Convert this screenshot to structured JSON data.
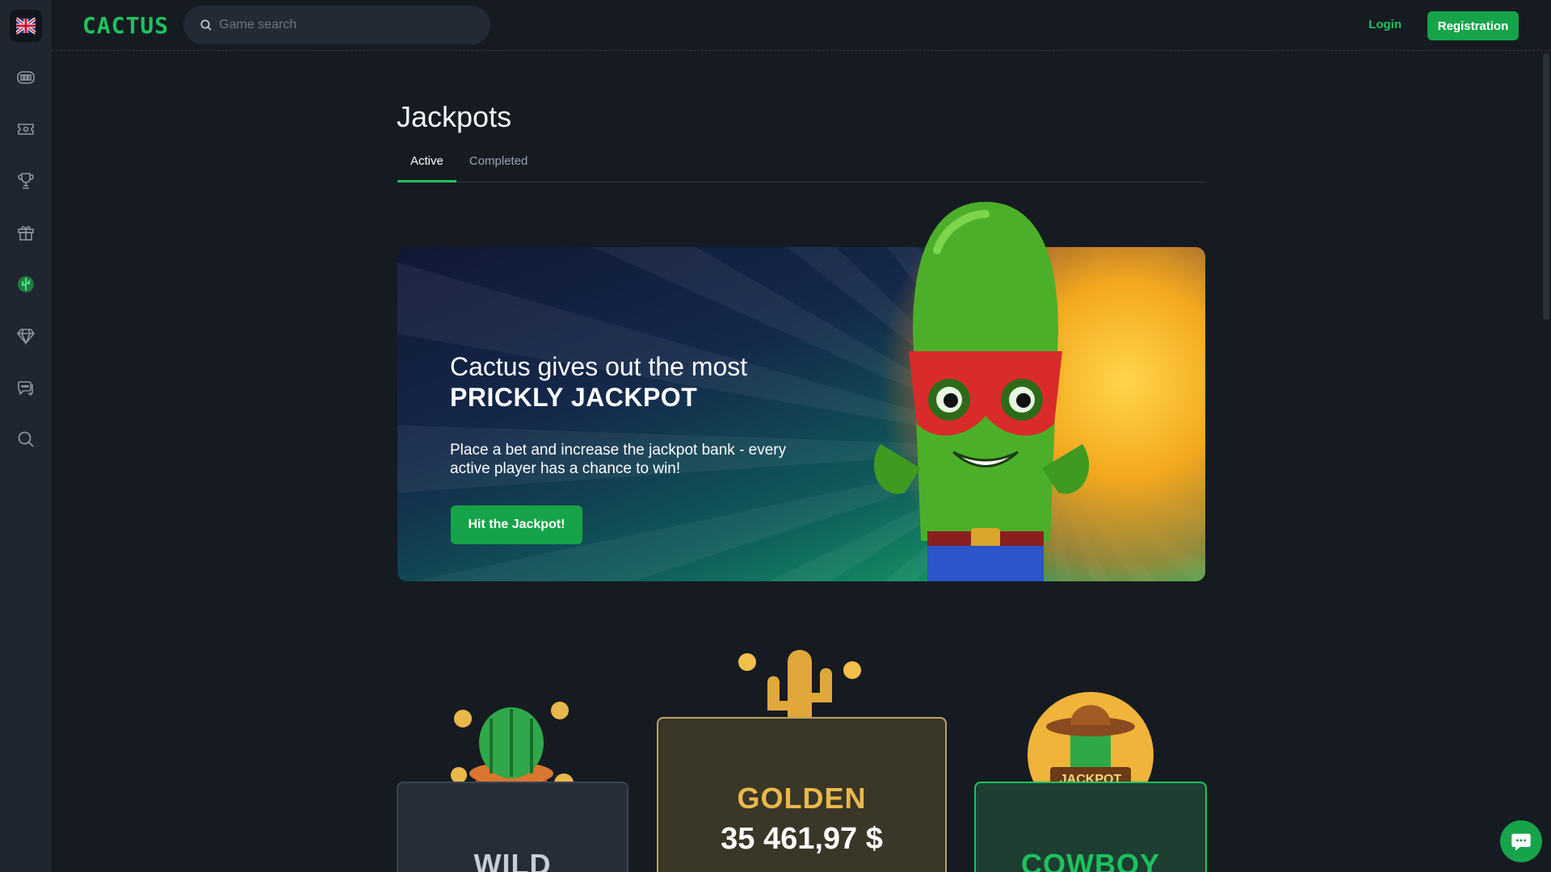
{
  "sidebar": {
    "items": [
      {
        "icon": "flag-uk-icon"
      },
      {
        "icon": "slots-icon"
      },
      {
        "icon": "live-casino-icon"
      },
      {
        "icon": "trophy-icon"
      },
      {
        "icon": "gift-icon"
      },
      {
        "icon": "jackpot-cactus-icon"
      },
      {
        "icon": "diamond-icon"
      },
      {
        "icon": "chat-bubbles-icon"
      },
      {
        "icon": "search-icon"
      }
    ],
    "active_color": "#1ec25e"
  },
  "header": {
    "logo": "CACTUS",
    "search_placeholder": "Game search",
    "login_label": "Login",
    "register_label": "Registration"
  },
  "page": {
    "title": "Jackpots",
    "tabs": [
      {
        "label": "Active",
        "active": true
      },
      {
        "label": "Completed",
        "active": false
      }
    ]
  },
  "banner": {
    "line1": "Cactus gives out the most",
    "line2": "PRICKLY JACKPOT",
    "description": "Place a bet and increase the jackpot bank - every active player has a chance to win!",
    "button_label": "Hit the Jackpot!"
  },
  "jackpots": [
    {
      "name": "WILD",
      "amount": ""
    },
    {
      "name": "GOLDEN",
      "amount": "35 461,97 $"
    },
    {
      "name": "COWBOY",
      "amount": ""
    }
  ],
  "colors": {
    "accent": "#1ec25e",
    "button": "#16a34a",
    "background": "#161b22",
    "sidebar": "#1f2630",
    "gold": "#e8b84a"
  }
}
